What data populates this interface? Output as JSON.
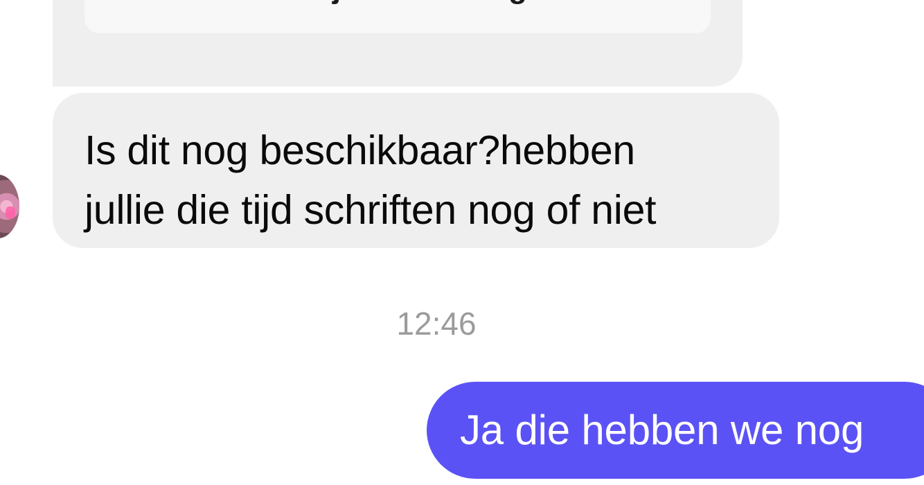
{
  "conversation": {
    "top_card": {
      "text": "Bekijk aanbieding"
    },
    "incoming_message": {
      "line1": "Is dit nog beschikbaar?hebben",
      "line2": "jullie die tijd schriften nog of niet"
    },
    "timestamp": "12:46",
    "outgoing_message": {
      "text": "Ja die hebben we nog"
    }
  },
  "colors": {
    "incoming_bubble": "#efefef",
    "outgoing_bubble": "#5b52f5",
    "timestamp_text": "#9b9b9b",
    "background": "#ffffff"
  }
}
